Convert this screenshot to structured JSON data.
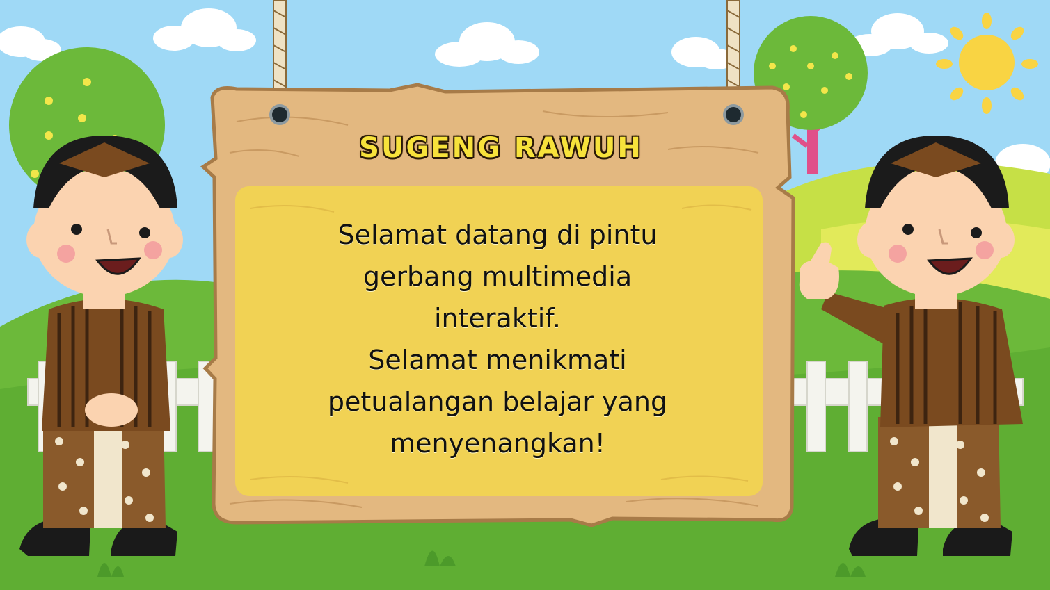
{
  "slide": {
    "title": "SUGENG RAWUH",
    "message_lines": [
      "Selamat datang di pintu",
      "gerbang multimedia",
      "interaktif.",
      "Selamat menikmati",
      "petualangan belajar yang",
      "menyenangkan!"
    ]
  },
  "colors": {
    "sky": "#9fd9f6",
    "hill_front": "#6cb93a",
    "hill_back": "#c6e046",
    "sign_wood": "#e3b880",
    "sign_border": "#a77b48",
    "panel": "#f1d254",
    "title_fill": "#f7e23b",
    "sun": "#f9d443",
    "shirt": "#7a4a1f",
    "hat": "#1b1b1b"
  },
  "icons": {
    "sun": "sun-icon",
    "tree": "tree-icon",
    "cloud": "cloud-icon",
    "fence": "fence-icon",
    "character_left": "javanese-boy-hands-folded",
    "character_right": "javanese-boy-thumbs-up"
  }
}
